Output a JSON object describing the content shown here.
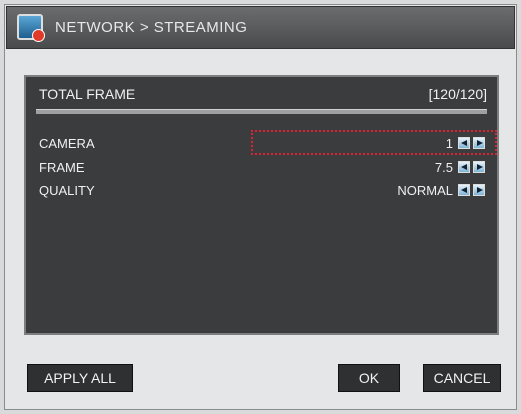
{
  "window": {
    "title": "NETWORK > STREAMING"
  },
  "total_frame": {
    "label": "TOTAL FRAME",
    "value": "[120/120]"
  },
  "settings": [
    {
      "label": "CAMERA",
      "value": "1"
    },
    {
      "label": "FRAME",
      "value": "7.5"
    },
    {
      "label": "QUALITY",
      "value": "NORMAL"
    }
  ],
  "buttons": {
    "apply_all": "APPLY ALL",
    "ok": "OK",
    "cancel": "CANCEL"
  },
  "colors": {
    "panel": "#3b3c3e",
    "focus": "#d22233",
    "arrow": "#7fb3d6"
  }
}
